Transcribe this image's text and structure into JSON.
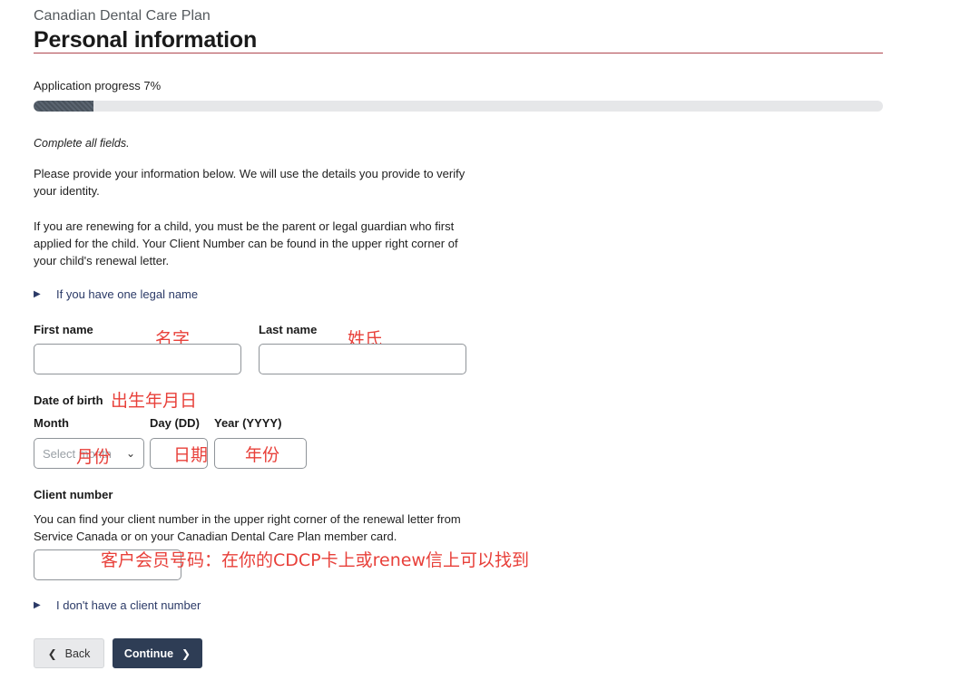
{
  "header": {
    "supertitle": "Canadian Dental Care Plan",
    "title": "Personal information"
  },
  "progress": {
    "label": "Application progress 7%",
    "percent": 7
  },
  "form": {
    "hint": "Complete all fields.",
    "intro": "Please provide your information below. We will use the details you provide to verify your identity.",
    "renewal_note": "If you are renewing for a child, you must be the parent or legal guardian who first applied for the child. Your Client Number can be found in the upper right corner of your child's renewal letter.",
    "one_legal_name_toggle": "If you have one legal name",
    "first_name_label": "First name",
    "last_name_label": "Last name",
    "dob_label": "Date of birth",
    "month_label": "Month",
    "month_placeholder": "Select month",
    "day_label": "Day (DD)",
    "year_label": "Year (YYYY)",
    "client_number_label": "Client number",
    "client_number_help": "You can find your client number in the upper right corner of the renewal letter from Service Canada or on your Canadian Dental Care Plan member card.",
    "no_client_number_toggle": "I don't have a client number"
  },
  "annotations": {
    "first_name": "名字",
    "last_name": "姓氏",
    "dob": "出生年月日",
    "month": "月份",
    "day": "日期",
    "year": "年份",
    "client_number": "客户会员号码：在你的CDCP卡上或renew信上可以找到"
  },
  "buttons": {
    "back": "Back",
    "continue": "Continue"
  },
  "icons": {
    "disclosure": "triangle-right-icon",
    "back_arrow": "chevron-left-icon",
    "continue_arrow": "chevron-right-icon",
    "select_chevron": "chevron-down-icon"
  },
  "colors": {
    "title_rule": "#b0464f",
    "primary_button": "#2e3d55",
    "link": "#2b3a67",
    "annotation": "#e8403a"
  }
}
